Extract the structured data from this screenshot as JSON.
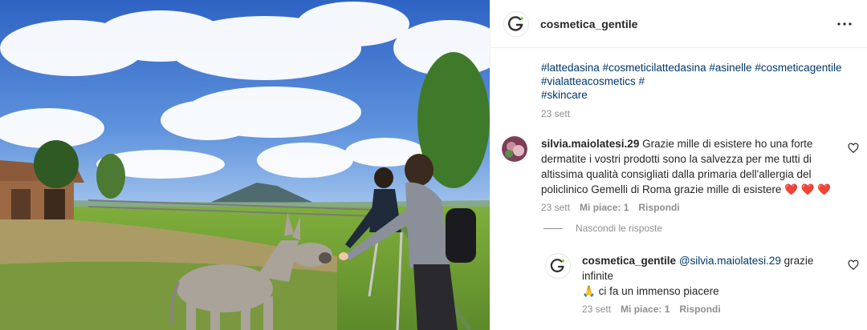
{
  "post": {
    "username": "cosmetica_gentile",
    "more_icon": "ellipsis-icon",
    "caption_hashtags_line1": "#lattedasina #cosmeticilattedasina #asinelle #cosmeticagentile",
    "caption_hashtags_line2": "#vialatteacosmetics #",
    "caption_hashtags_line3": "#skincare",
    "caption_time": "23 sett"
  },
  "comments": [
    {
      "username": "silvia.maiolatesi.29",
      "text": "Grazie mille di esistere ho una forte dermatite i vostri prodotti sono la salvezza per me tutti di altissima qualità consigliati dalla primaria dell'allergia del policlinico Gemelli di Roma grazie mille di esistere",
      "emoji": "❤️ ❤️ ❤️",
      "time": "23 sett",
      "likes": "Mi piace: 1",
      "reply": "Rispondi"
    }
  ],
  "replies_toggle": "Nascondi le risposte",
  "replies": [
    {
      "username": "cosmetica_gentile",
      "mention": "@silvia.maiolatesi.29",
      "text_part1": " grazie infinite",
      "emoji": "🙏",
      "text_part2": " ci fa un immenso piacere",
      "time": "23 sett",
      "likes": "Mi piace: 1",
      "reply": "Rispondi"
    }
  ],
  "colors": {
    "link": "#00376b",
    "muted": "#8e8e8e",
    "heart": "#ed4956",
    "brand_green": "#7cc242"
  }
}
